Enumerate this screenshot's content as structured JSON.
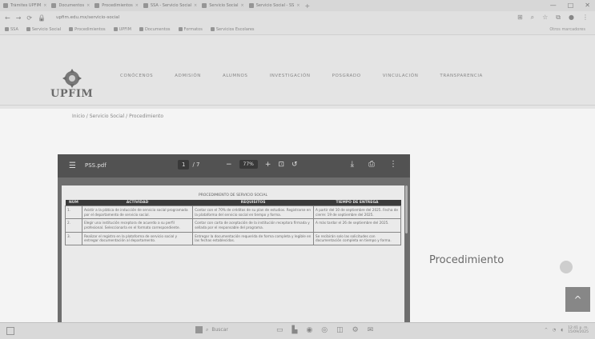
{
  "browser": {
    "tabs": [
      "Trámites UPFIM",
      "Documentos",
      "Procedimientos",
      "SSA - Servicio Social",
      "Servicio Social",
      "Servicio Social - SS"
    ],
    "new_tab": "+",
    "window_controls": [
      "—",
      "□",
      "✕"
    ],
    "url": "upfim.edu.mx/servicio-social",
    "bookmarks": [
      "SSA",
      "Servicio Social",
      "Procedimientos",
      "UPFIM",
      "Documentos",
      "Formatos",
      "Servicios Escolares"
    ],
    "bookmarks_more": "Otros marcadores"
  },
  "site": {
    "logo_text": "UPFIM",
    "nav": [
      "CONÓCENOS",
      "ADMISIÓN",
      "ALUMNOS",
      "INVESTIGACIÓN",
      "POSGRADO",
      "VINCULACIÓN",
      "TRANSPARENCIA"
    ],
    "breadcrumb": "Inicio / Servicio Social / Procedimiento"
  },
  "pdf": {
    "file_name": "PSS.pdf",
    "page_current": "1",
    "page_total": "/ 7",
    "zoom": "77%",
    "doc_title": "PROCEDIMIENTO DE SERVICIO SOCIAL",
    "columns": [
      "NÚM",
      "ACTIVIDAD",
      "REQUISITOS",
      "TIEMPO DE ENTREGA"
    ],
    "rows": [
      {
        "num": "1.",
        "activity": "Asistir a la plática de inducción de servicio social programada por el departamento de servicio social.",
        "requirements": "Contar con el 70% de créditos de su plan de estudios. Registrarse en la plataforma del servicio social en tiempo y forma.",
        "time": "A partir del 10 de septiembre del 2025. Fecha de cierre: 19 de septiembre del 2025."
      },
      {
        "num": "2.",
        "activity": "Elegir una institución receptora de acuerdo a su perfil profesional. Seleccionarla en el formato correspondiente.",
        "requirements": "Contar con carta de aceptación de la institución receptora firmada y sellada por el responsable del programa.",
        "time": "A más tardar el 26 de septiembre del 2025."
      },
      {
        "num": "3.",
        "activity": "Realizar el registro en la plataforma de servicio social y entregar documentación al departamento.",
        "requirements": "Entregar la documentación requerida de forma completa y legible en las fechas establecidas.",
        "time": "Se recibirán solo las solicitudes con documentación completa en tiempo y forma."
      }
    ]
  },
  "page": {
    "procedure_heading": "Procedimiento",
    "back_to_top": "^"
  },
  "taskbar": {
    "search": "Buscar",
    "time": "12:41 p. m.",
    "date": "15/09/2025"
  }
}
